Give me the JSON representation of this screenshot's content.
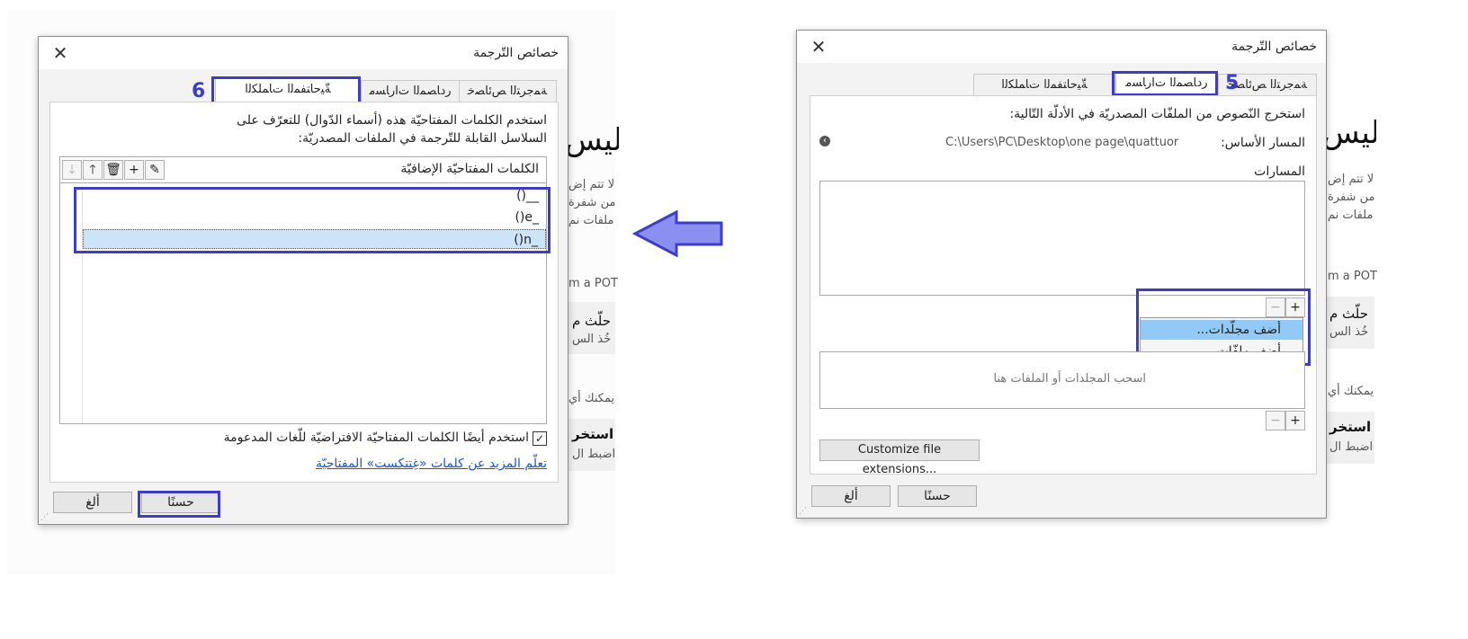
{
  "background": {
    "left": {
      "heading": "ليس",
      "lines": [
        "لا تتم إض",
        "من شفرة",
        "ملفات نم"
      ],
      "pot": "m a POT",
      "card1_title": "حلّث م",
      "card1_sub": "خُذ الس",
      "you_can": "يمكنك أي",
      "card2_title": "استخر",
      "card2_sub": "اضبط ال"
    },
    "right": {
      "heading": "ليس",
      "lines": [
        "لا تتم إض",
        "من شفرة",
        "ملفات نم"
      ],
      "pot": "m a POT",
      "card1_title": "حلّث م",
      "card1_sub": "خُذ الس",
      "you_can": "يمكنك أي",
      "card2_title": "استخر",
      "card2_sub": "اضبط ال"
    }
  },
  "arrow": {
    "color": "#3d3dc8"
  },
  "dialog_left": {
    "title": "خصائص التّرجمة",
    "tabs": [
      "ﺔﻤﺟﺮﺘﻟا ﺺﺋﺎﺼﺧ",
      "ﺭﺩﺎﺼﻤﻟا ﺕﺍﺭﺎﺴﻣ",
      "ﺔّﻴﺣﺎﺘﻔﻤﻟا ﺕﺎﻤﻠﻜﻟا"
    ],
    "step_number": "6",
    "intro_line1": "استخدم الكلمات المفتاحيّة هذه (أسماء الدّوال) للتعرّف على",
    "intro_line2": "السلاسل القابلة للتّرجمة في الملفات المصدريّة:",
    "keywords_header": "الكلمات المفتاحيّة الإضافيّة",
    "toolbar_icons": [
      "edit-icon",
      "add-icon",
      "delete-icon",
      "move-up-icon",
      "move-down-icon"
    ],
    "keywords": [
      "()__",
      "()e_",
      "()n_"
    ],
    "checkbox_checked": true,
    "checkbox_label": "استخدم أيضًا الكلمات المفتاحيّة الافتراضيّة للّغات المدعومة",
    "learn_more": "تعلّم المزيد عن كلمات «غِتتكست» المفتاحيّة",
    "ok": "حسنًا",
    "cancel": "ألغ"
  },
  "dialog_right": {
    "title": "خصائص التّرجمة",
    "tabs": [
      "ﺔﻤﺟﺮﺘﻟا ﺺﺋﺎﺼﺧ",
      "ﺭﺩﺎﺼﻤﻟا ﺕﺍﺭﺎﺴﻣ",
      "ﺔّﻴﺣﺎﺘﻔﻤﻟا ﺕﺎﻤﻠﻜﻟا"
    ],
    "step_number": "5",
    "intro": "استخرج النّصوص من الملفّات المصدريّة في الأدلّة التّالية:",
    "base_path_label": "المسار الأساس:",
    "base_path_value": "C:\\Users\\PC\\Desktop\\one page\\quattuor",
    "paths_label": "المسارات",
    "menu_items": [
      "أضف مجلّدات...",
      "أضف ملفّات..."
    ],
    "drop_hint": "اسحب المجلدات أو الملفات هنا",
    "customize": "Customize file extensions...",
    "ok": "حسنًا",
    "cancel": "ألغ"
  }
}
